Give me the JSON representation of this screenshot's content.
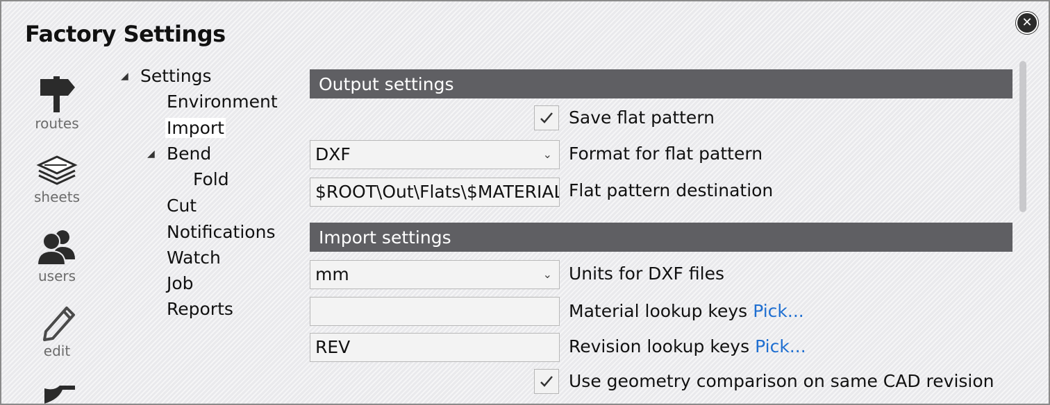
{
  "window": {
    "title": "Factory Settings"
  },
  "rail": {
    "items": [
      {
        "label": "routes",
        "icon": "signpost-icon"
      },
      {
        "label": "sheets",
        "icon": "layers-icon"
      },
      {
        "label": "users",
        "icon": "users-icon"
      },
      {
        "label": "edit",
        "icon": "pencil-icon"
      },
      {
        "label": "",
        "icon": "machine-icon"
      }
    ]
  },
  "tree": {
    "root": "Settings",
    "items": [
      "Environment",
      "Import",
      "Bend",
      "Fold",
      "Cut",
      "Notifications",
      "Watch",
      "Job",
      "Reports"
    ],
    "selected": "Import"
  },
  "output": {
    "header": "Output settings",
    "save_flat_pattern": {
      "label": "Save flat pattern",
      "checked": true
    },
    "format": {
      "value": "DXF",
      "label": "Format for flat pattern"
    },
    "destination": {
      "value": "$ROOT\\Out\\Flats\\$MATERIAL",
      "label": "Flat pattern destination"
    }
  },
  "import": {
    "header": "Import settings",
    "units": {
      "value": "mm",
      "label": "Units for DXF files"
    },
    "material_keys": {
      "value": "",
      "label": "Material lookup keys",
      "link": "Pick..."
    },
    "revision_keys": {
      "value": "REV",
      "label": "Revision lookup keys",
      "link": "Pick..."
    },
    "geometry_comparison": {
      "label": "Use geometry comparison on same CAD revision",
      "checked": true
    }
  },
  "colors": {
    "section_header_bg": "#5f5f63",
    "link": "#1f6fd1"
  }
}
